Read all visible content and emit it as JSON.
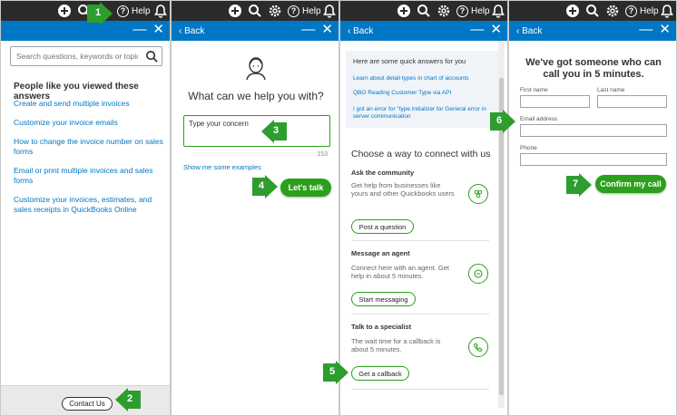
{
  "topbar": {
    "help_label": "Help"
  },
  "panel1": {
    "search_placeholder": "Search questions, keywords or topics",
    "heading": "People like you viewed these answers",
    "links": [
      "Create and send multiple invoices",
      "Customize your invoice emails",
      "How to change the invoice number on sales forms",
      "Email or print multiple invoices and sales forms",
      "Customize your invoices, estimates, and sales receipts in QuickBooks Online"
    ],
    "contact_label": "Contact Us"
  },
  "panel2": {
    "back_label": "Back",
    "title": "What can we help you with?",
    "concern_value": "Type your concern",
    "char_count": "153",
    "examples_link": "Show me some examples",
    "lets_talk_label": "Let's talk"
  },
  "panel3": {
    "back_label": "Back",
    "quick_heading": "Here are some quick answers for you",
    "quick_links": [
      "Learn about detail types in chart of accounts",
      "QBO Reading Customer Type via API",
      "I got an error for \"type initializer for General error in server communication"
    ],
    "connect_title": "Choose a way to connect with us",
    "community": {
      "heading": "Ask the community",
      "text": "Get help from businesses like yours and other Quickbooks users",
      "button": "Post a question"
    },
    "agent": {
      "heading": "Message an agent",
      "text": "Connect here with an agent. Get help in about 5 minutes.",
      "button": "Start messaging"
    },
    "specialist": {
      "heading": "Talk to a specialist",
      "text": "The wait time for a callback is about 5 minutes.",
      "button": "Get a callback"
    }
  },
  "panel4": {
    "back_label": "Back",
    "title_line1": "We've got someone who can",
    "title_line2": "call you in 5 minutes.",
    "first_name_label": "First name",
    "last_name_label": "Last name",
    "email_label": "Email address",
    "phone_label": "Phone",
    "confirm_label": "Confirm my call"
  },
  "steps": [
    "1",
    "2",
    "3",
    "4",
    "5",
    "6",
    "7"
  ],
  "colors": {
    "accent_blue": "#0077c5",
    "accent_green": "#2ca01c",
    "topbar": "#2b2b2b",
    "step_green": "#2d9d2d"
  }
}
